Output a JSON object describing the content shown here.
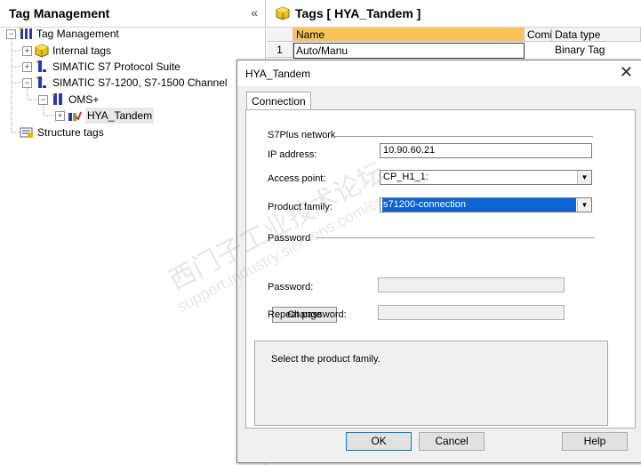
{
  "left_panel": {
    "title": "Tag Management",
    "collapse_glyph": "«",
    "tree": [
      {
        "label": "Tag Management",
        "expander": "−",
        "icon": "tag-management-icon"
      },
      {
        "label": "Internal tags",
        "expander": "+",
        "icon": "internal-tags-icon"
      },
      {
        "label": "SIMATIC S7 Protocol Suite",
        "expander": "+",
        "icon": "channel-icon"
      },
      {
        "label": "SIMATIC S7-1200, S7-1500 Channel",
        "expander": "−",
        "icon": "channel-icon"
      },
      {
        "label": "OMS+",
        "expander": "−",
        "icon": "unit-icon"
      },
      {
        "label": "HYA_Tandem",
        "expander": "+",
        "icon": "connection-icon"
      },
      {
        "label": "Structure tags",
        "expander": "",
        "icon": "structure-tags-icon"
      }
    ]
  },
  "right_panel": {
    "title": "Tags [ HYA_Tandem ]",
    "columns": [
      "Name",
      "Comi",
      "Data type"
    ],
    "rows": [
      {
        "num": "1",
        "name": "Auto/Manu",
        "type": "Binary Tag"
      }
    ]
  },
  "dialog": {
    "title": "HYA_Tandem",
    "close_glyph": "✕",
    "tab": "Connection",
    "s7plus_section": "S7Plus network",
    "ip_label": "IP address:",
    "ip_value": "10.90.60.21",
    "access_label": "Access point:",
    "access_value": "CP_H1_1:",
    "family_label": "Product family:",
    "family_value": "s71200-connection",
    "password_section": "Password",
    "change_button": "Change",
    "password_label": "Password:",
    "repeat_label": "Repeat password:",
    "info_text": "Select the product family.",
    "ok": "OK",
    "cancel": "Cancel",
    "help": "Help"
  },
  "watermark": {
    "line1": "西门子工业技术论坛",
    "line2": "support.industry.siemens.com/cs"
  },
  "colors": {
    "header_accent": "#f7c35a",
    "selection_blue": "#0a64d2"
  }
}
